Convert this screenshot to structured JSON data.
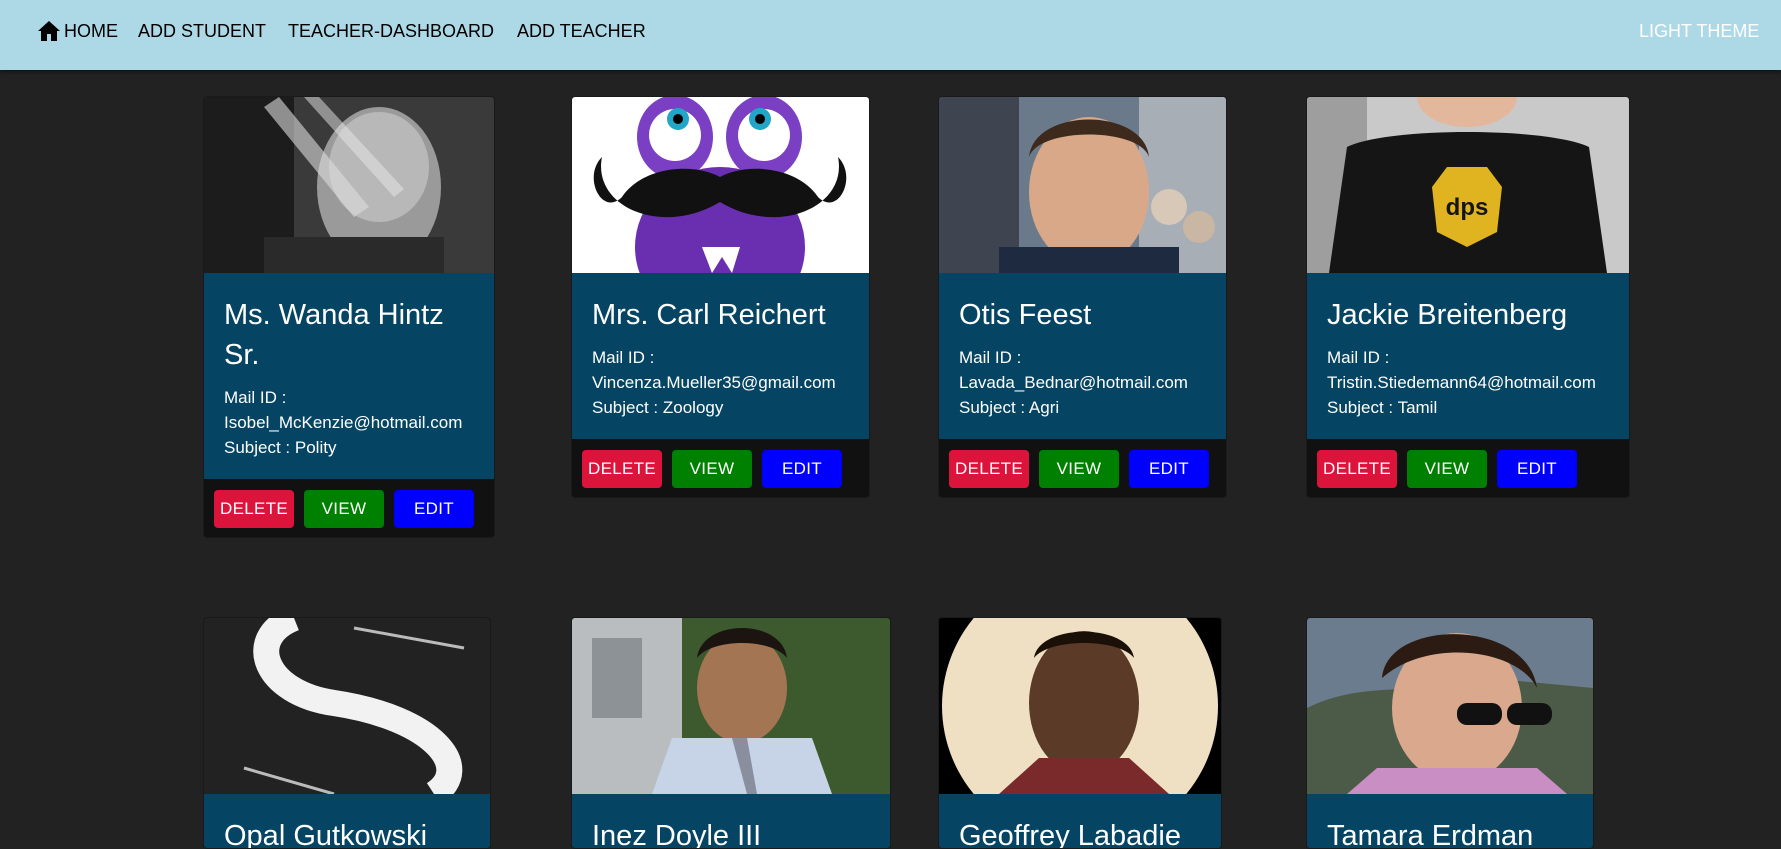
{
  "nav": {
    "home": "HOME",
    "add_student": "ADD STUDENT",
    "teacher_dashboard": "TEACHER-DASHBOARD",
    "add_teacher": "ADD TEACHER",
    "theme_toggle": "LIGHT THEME"
  },
  "teachers": [
    {
      "name": "Ms. Wanda Hintz Sr.",
      "mail_label": "Mail ID :",
      "email": "Isobel_McKenzie@hotmail.com",
      "subject_label": "Subject : Polity"
    },
    {
      "name": "Mrs. Carl Reichert",
      "mail_label": "Mail ID :",
      "email": "Vincenza.Mueller35@gmail.com",
      "subject_label": "Subject : Zoology"
    },
    {
      "name": "Otis Feest",
      "mail_label": "Mail ID :",
      "email": "Lavada_Bednar@hotmail.com",
      "subject_label": "Subject : Agri"
    },
    {
      "name": "Jackie Breitenberg",
      "mail_label": "Mail ID :",
      "email": "Tristin.Stiedemann64@hotmail.com",
      "subject_label": "Subject : Tamil"
    },
    {
      "name": "Opal Gutkowski"
    },
    {
      "name": "Inez Doyle III"
    },
    {
      "name": "Geoffrey Labadie"
    },
    {
      "name": "Tamara Erdman"
    }
  ],
  "buttons": {
    "delete": "DELETE",
    "view": "VIEW",
    "edit": "EDIT"
  },
  "colors": {
    "navbar": "#add8e6",
    "background": "#222222",
    "card_body": "#054563",
    "delete": "#dc143c",
    "view": "#008000",
    "edit": "#0000ff"
  }
}
